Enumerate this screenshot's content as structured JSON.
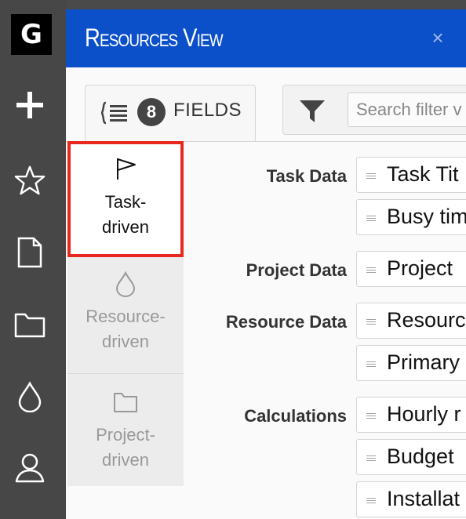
{
  "rail": {
    "logo": "G",
    "icons": [
      "plus-icon",
      "star-icon",
      "document-icon",
      "folder-icon",
      "drop-icon",
      "user-icon"
    ]
  },
  "panel": {
    "title": "Resources View",
    "close": "×"
  },
  "tabs": {
    "fields_count": "8",
    "fields_label": "FIELDS"
  },
  "filter": {
    "placeholder": "Search filter v"
  },
  "modes": [
    {
      "label_1": "Task-",
      "label_2": "driven",
      "icon": "flag-icon",
      "active": true
    },
    {
      "label_1": "Resource-",
      "label_2": "driven",
      "icon": "drop-icon",
      "active": false
    },
    {
      "label_1": "Project-",
      "label_2": "driven",
      "icon": "folder-icon",
      "active": false
    }
  ],
  "sections": {
    "task_data": "Task Data",
    "project_data": "Project Data",
    "resource_data": "Resource Data",
    "calculations": "Calculations"
  },
  "fields": [
    "Task Tit",
    "Busy tim",
    "Project",
    "Resourc",
    "Primary",
    "Hourly r",
    "Budget",
    "Installat"
  ],
  "colors": {
    "titlebar": "#0b4fc9",
    "active_outline": "#e8281e",
    "rail": "#474747"
  }
}
